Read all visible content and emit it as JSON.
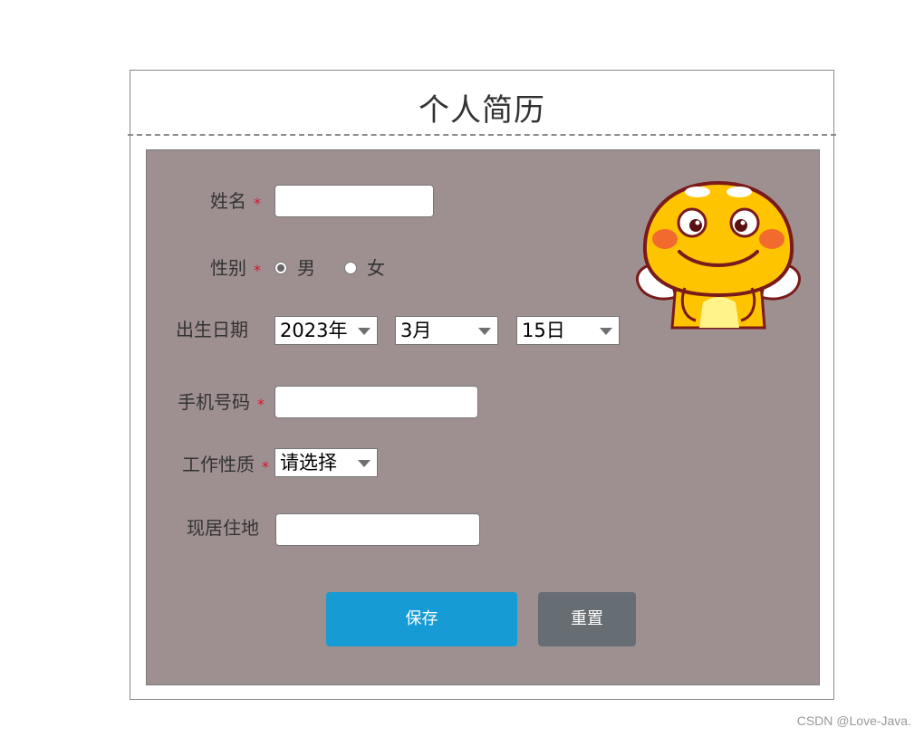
{
  "form": {
    "title": "个人简历",
    "fields": {
      "name": {
        "label": "姓名",
        "required_mark": "*",
        "value": ""
      },
      "gender": {
        "label": "性别",
        "required_mark": "*",
        "options": [
          "男",
          "女"
        ],
        "selected": "男"
      },
      "birthdate": {
        "label": "出生日期",
        "year": "2023年",
        "month": "3月",
        "day": "15日"
      },
      "phone": {
        "label": "手机号码",
        "required_mark": "*",
        "value": ""
      },
      "job_type": {
        "label": "工作性质",
        "required_mark": "*",
        "selected": "请选择"
      },
      "address": {
        "label": "现居住地",
        "value": ""
      }
    },
    "buttons": {
      "save": "保存",
      "reset": "重置"
    },
    "mascot_icon": "yellow-cartoon-mascot-icon"
  },
  "watermark": "CSDN @Love-Java.",
  "colors": {
    "panel_bg": "#9e9090",
    "save_button": "#169bd5",
    "reset_button": "#666d73",
    "required_star": "#e0102a"
  }
}
